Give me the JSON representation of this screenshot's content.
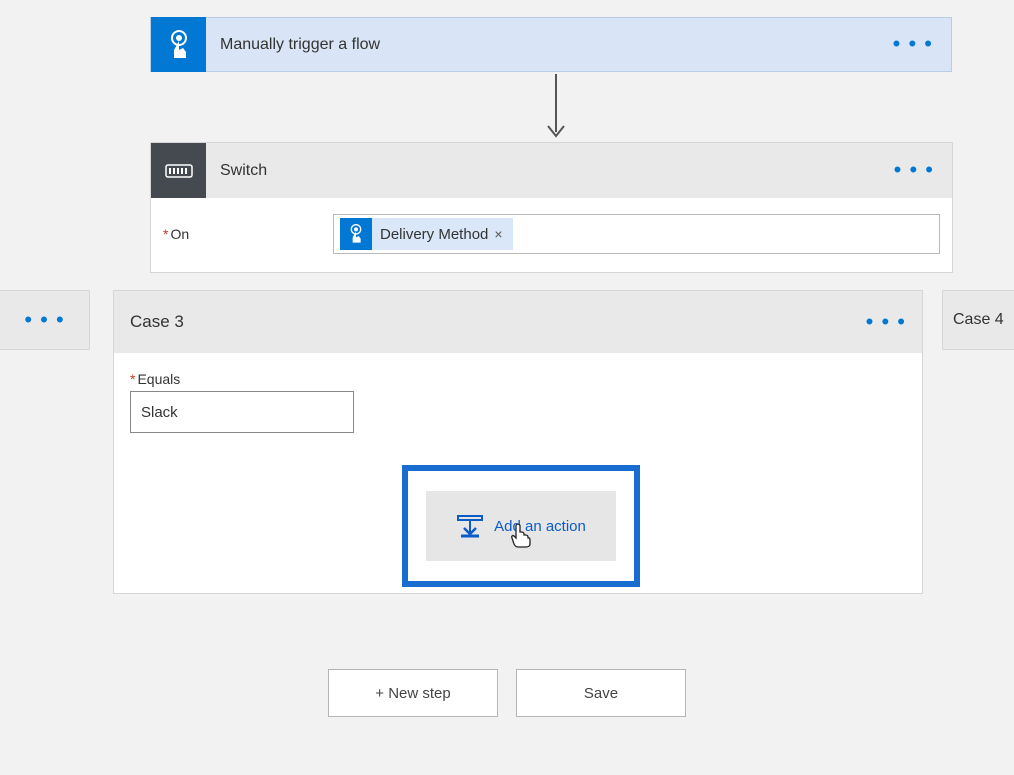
{
  "trigger": {
    "title": "Manually trigger a flow",
    "icon": "touch-icon"
  },
  "switch": {
    "title": "Switch",
    "on_label": "On",
    "token": {
      "icon": "touch-icon",
      "label": "Delivery Method",
      "remove": "×"
    }
  },
  "cases": {
    "prev_has_ellipsis": true,
    "case3": {
      "title": "Case 3",
      "equals_label": "Equals",
      "equals_value": "Slack",
      "add_action_label": "Add an action"
    },
    "next": {
      "title": "Case 4"
    }
  },
  "footer": {
    "new_step": "+ New step",
    "save": "Save"
  }
}
